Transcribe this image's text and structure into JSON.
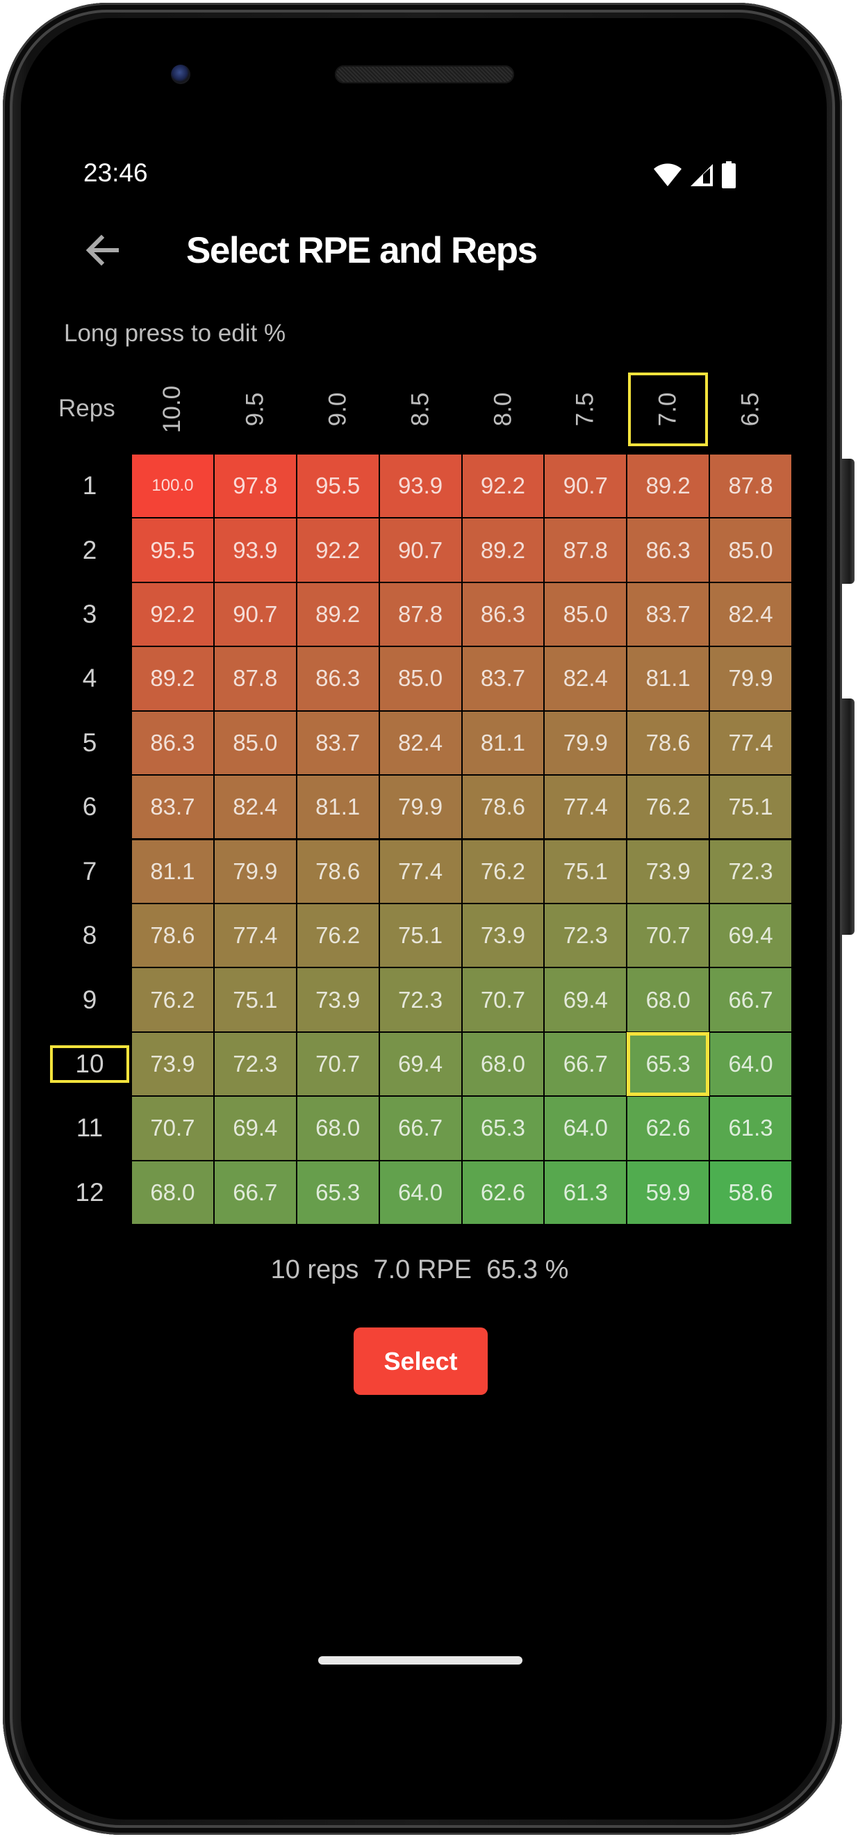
{
  "status_bar": {
    "time": "23:46",
    "icons": [
      "wifi-icon",
      "cell-signal-icon",
      "battery-icon"
    ]
  },
  "app_bar": {
    "back_icon": "arrow-left-icon",
    "title": "Select RPE and Reps"
  },
  "hint": "Long press to edit %",
  "table": {
    "reps_header": "Reps",
    "rpe_columns": [
      "10.0",
      "9.5",
      "9.0",
      "8.5",
      "8.0",
      "7.5",
      "7.0",
      "6.5"
    ],
    "reps_rows": [
      "1",
      "2",
      "3",
      "4",
      "5",
      "6",
      "7",
      "8",
      "9",
      "10",
      "11",
      "12"
    ],
    "values": [
      [
        "100.0",
        "97.8",
        "95.5",
        "93.9",
        "92.2",
        "90.7",
        "89.2",
        "87.8"
      ],
      [
        "95.5",
        "93.9",
        "92.2",
        "90.7",
        "89.2",
        "87.8",
        "86.3",
        "85.0"
      ],
      [
        "92.2",
        "90.7",
        "89.2",
        "87.8",
        "86.3",
        "85.0",
        "83.7",
        "82.4"
      ],
      [
        "89.2",
        "87.8",
        "86.3",
        "85.0",
        "83.7",
        "82.4",
        "81.1",
        "79.9"
      ],
      [
        "86.3",
        "85.0",
        "83.7",
        "82.4",
        "81.1",
        "79.9",
        "78.6",
        "77.4"
      ],
      [
        "83.7",
        "82.4",
        "81.1",
        "79.9",
        "78.6",
        "77.4",
        "76.2",
        "75.1"
      ],
      [
        "81.1",
        "79.9",
        "78.6",
        "77.4",
        "76.2",
        "75.1",
        "73.9",
        "72.3"
      ],
      [
        "78.6",
        "77.4",
        "76.2",
        "75.1",
        "73.9",
        "72.3",
        "70.7",
        "69.4"
      ],
      [
        "76.2",
        "75.1",
        "73.9",
        "72.3",
        "70.7",
        "69.4",
        "68.0",
        "66.7"
      ],
      [
        "73.9",
        "72.3",
        "70.7",
        "69.4",
        "68.0",
        "66.7",
        "65.3",
        "64.0"
      ],
      [
        "70.7",
        "69.4",
        "68.0",
        "66.7",
        "65.3",
        "64.0",
        "62.6",
        "61.3"
      ],
      [
        "68.0",
        "66.7",
        "65.3",
        "64.0",
        "62.6",
        "61.3",
        "59.9",
        "58.6"
      ]
    ],
    "selected_rpe": "7.0",
    "selected_reps": "10",
    "color_high": "#F44336",
    "color_low": "#4CAF50",
    "highlight_color": "#F5E33C"
  },
  "summary": "10 reps  7.0 RPE  65.3 %",
  "select_button": {
    "label": "Select",
    "color": "#F44336"
  }
}
